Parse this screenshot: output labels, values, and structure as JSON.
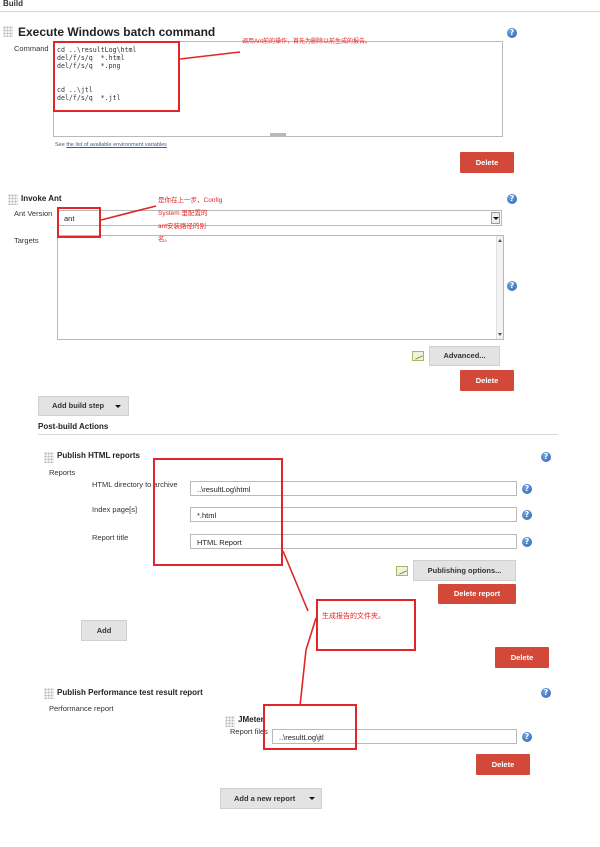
{
  "build": {
    "header": "Build"
  },
  "batch": {
    "title": "Execute Windows batch command",
    "command_label": "Command",
    "command_text": "cd ..\\resultLog\\html\ndel/f/s/q  *.html\ndel/f/s/q  *.png\n\n\ncd ..\\jtl\ndel/f/s/q  *.jtl",
    "see_prefix": "See",
    "see_link": "the list of available environment variables",
    "delete_label": "Delete",
    "note": "调用Ant前的操作，首先为删除以前生成的报告。"
  },
  "ant": {
    "title": "Invoke Ant",
    "version_label": "Ant Version",
    "version_value": "ant",
    "targets_label": "Targets",
    "advanced_label": "Advanced...",
    "delete_label": "Delete",
    "note_lines": [
      "是你在上一步，Config",
      "System 里配置的",
      "ant安装路径的别",
      "名。"
    ]
  },
  "add_build_step": "Add build step",
  "post_build": {
    "header": "Post-build Actions"
  },
  "html_reports": {
    "title": "Publish HTML reports",
    "reports_label": "Reports",
    "dir_label": "HTML directory to archive",
    "dir_value": "..\\resultLog\\html",
    "index_label": "Index page[s]",
    "index_value": "*.html",
    "title_label": "Report title",
    "title_value": "HTML Report",
    "publishing_label": "Publishing options...",
    "delete_report_label": "Delete report",
    "add_label": "Add",
    "delete_label": "Delete",
    "note": "生成报告的文件夹。"
  },
  "perf": {
    "title": "Publish Performance test result report",
    "report_label": "Performance report",
    "jmeter_label": "JMeter",
    "report_files_label": "Report files",
    "report_files_value": "..\\resultLog\\jtl",
    "delete_label": "Delete"
  },
  "add_report": "Add a new report",
  "colors": {
    "accent_red": "#d24939",
    "annotation_red": "#e02727",
    "help_blue": "#2b62b3"
  }
}
